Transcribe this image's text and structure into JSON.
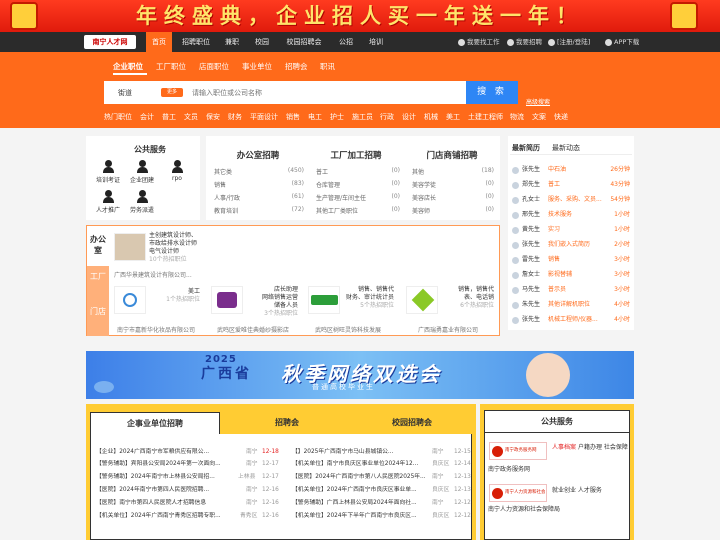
{
  "banner": {
    "slogan": "年终盛典，企业招人买一年送一年！"
  },
  "nav": {
    "logo": "南宁人才网",
    "items": [
      "首页",
      "招聘职位",
      "兼职",
      "校园",
      "校园招聘会",
      "公招",
      "培训"
    ],
    "right": [
      "我要找工作",
      "我要招聘",
      "[注册/登陆]",
      "APP下载"
    ]
  },
  "search": {
    "categories": [
      "企业职位",
      "工厂职位",
      "店面职位",
      "事业单位",
      "招聘会",
      "职讯"
    ],
    "city": "街道",
    "change_label": "更多",
    "placeholder": "请输入职位或公司名称",
    "button": "搜 索",
    "advanced": "高级搜索",
    "quick_links": [
      "热门职位",
      "会计",
      "普工",
      "文员",
      "保安",
      "财务",
      "平面设计",
      "销售",
      "电工",
      "护士",
      "施工员",
      "行政",
      "设计",
      "机械",
      "美工",
      "土建工程师",
      "物流",
      "文案",
      "快递"
    ]
  },
  "public_services": {
    "title": "公共服务",
    "items": [
      "培训考证",
      "企业团建",
      "rpo",
      "人才推广",
      "劳务派遣"
    ]
  },
  "job_columns": [
    {
      "title": "办公室招聘",
      "rows": [
        [
          "其它类",
          "(450)"
        ],
        [
          "销售",
          "(83)"
        ],
        [
          "人事/行政",
          "(61)"
        ],
        [
          "教育培训",
          "(72)"
        ]
      ]
    },
    {
      "title": "工厂加工招聘",
      "rows": [
        [
          "普工",
          "(0)"
        ],
        [
          "仓库管理",
          "(0)"
        ],
        [
          "生产管理/车间主任",
          "(0)"
        ],
        [
          "其他工厂类职位",
          "(0)"
        ]
      ]
    },
    {
      "title": "门店商铺招聘",
      "rows": [
        [
          "其他",
          "(18)"
        ],
        [
          "美容学徒",
          "(0)"
        ],
        [
          "美容店长",
          "(0)"
        ],
        [
          "美容师",
          "(0)"
        ]
      ]
    }
  ],
  "featured": {
    "side_tabs": [
      "办公室",
      "工厂",
      "门店"
    ],
    "top": {
      "jobs": [
        "主创建筑设计师、",
        "市政给排水设计师",
        "电气设计师"
      ],
      "count": "10个热招职位",
      "company": "广西华景建筑设计有限公司..."
    },
    "cards": [
      {
        "jobs": [
          "美工"
        ],
        "count": "1个热招职位",
        "company": "南宁市嘉新华化妆品有限公司"
      },
      {
        "jobs": [
          "店长助理",
          "网络销售运营",
          "储备人员"
        ],
        "count": "3个热招职位",
        "company": "武鸣区爱唯佳典婚纱摄影店"
      },
      {
        "jobs": [
          "销售、销售代",
          "财务、审计统计员"
        ],
        "count": "5个热招职位",
        "company": "武鸣区树旺灵饰科技发展"
      },
      {
        "jobs": [
          "销售，销售代",
          "表、电话销"
        ],
        "count": "6个热招职位",
        "company": "广西瑞勇嘉业有限公司"
      }
    ]
  },
  "news": {
    "tabs": [
      "最新简历",
      "最新动态"
    ],
    "rows": [
      {
        "who": "张先生",
        "what": "中石油",
        "when": "26分钟"
      },
      {
        "who": "郑先生",
        "what": "普工",
        "when": "43分钟"
      },
      {
        "who": "孔女士",
        "what": "服务、采购、文员...",
        "when": "54分钟"
      },
      {
        "who": "邢先生",
        "what": "技术服务",
        "when": "1小时"
      },
      {
        "who": "黄先生",
        "what": "实习",
        "when": "1小时"
      },
      {
        "who": "张先生",
        "what": "我们嵌入式简历",
        "when": "2小时"
      },
      {
        "who": "雷先生",
        "what": "销售",
        "when": "3小时"
      },
      {
        "who": "詹女士",
        "what": "影视替辅",
        "when": "3小时"
      },
      {
        "who": "马先生",
        "what": "普示员",
        "when": "3小时"
      },
      {
        "who": "朱先生",
        "what": "其他详解机职位",
        "when": "4小时"
      },
      {
        "who": "张先生",
        "what": "机械工程师/仪器...",
        "when": "4小时"
      }
    ]
  },
  "ad": {
    "year": "2025",
    "prov": "广西省",
    "main": "秋季网络双选会",
    "sub": "普通高校毕业生"
  },
  "bottom": {
    "tabs": [
      "企事业单位招聘",
      "招聘会",
      "校园招聘会"
    ],
    "left": [
      {
        "t": "【企业】2024广西南宁市军粮供应有限公...",
        "loc": "南宁",
        "dt": "12-18",
        "red": true
      },
      {
        "t": "【警务辅助】宾阳县公安局2024年第一次面向...",
        "loc": "南宁",
        "dt": "12-17",
        "red": false
      },
      {
        "t": "【警务辅助】2024年南宁市上林县公安局招...",
        "loc": "上林县",
        "dt": "12-17",
        "red": false
      },
      {
        "t": "【医院】2024年南宁市第四人民医院招聘...",
        "loc": "南宁",
        "dt": "12-16",
        "red": false
      },
      {
        "t": "【医院】南宁市第四人民医院人才招聘信息",
        "loc": "南宁",
        "dt": "12-16",
        "red": false
      },
      {
        "t": "【机关单位】2024年广西南宁青秀区招聘专职...",
        "loc": "青秀区",
        "dt": "12-16",
        "red": false
      }
    ],
    "right": [
      {
        "t": "【】2025年广西南宁市马山县城镇公...",
        "loc": "南宁",
        "dt": "12-15"
      },
      {
        "t": "【机关单位】南宁市良庆区事业单位2024年12...",
        "loc": "良庆区",
        "dt": "12-14"
      },
      {
        "t": "【医院】2024年广西南宁市第八人民医院2025年...",
        "loc": "南宁",
        "dt": "12-13"
      },
      {
        "t": "【机关单位】2024年广西南宁市良庆区事业单...",
        "loc": "良庆区",
        "dt": "12-13"
      },
      {
        "t": "【警务辅助】广西上林县公安局2024年面向社...",
        "loc": "南宁",
        "dt": "12-12"
      },
      {
        "t": "【机关单位】2024年下半年广西南宁市良庆区...",
        "loc": "良庆区",
        "dt": "12-12"
      }
    ]
  },
  "pub": {
    "title": "公共服务",
    "items": [
      {
        "emblem": "南宁政务服务网",
        "hl": "人事档案",
        "rest": "户籍办理 社会保障",
        "name": "南宁政务服务网"
      },
      {
        "emblem": "南宁人力资源和社会保障局",
        "hl": "",
        "rest": "就业创业  人才服务",
        "name": "南宁人力资源和社会保障局"
      }
    ]
  }
}
